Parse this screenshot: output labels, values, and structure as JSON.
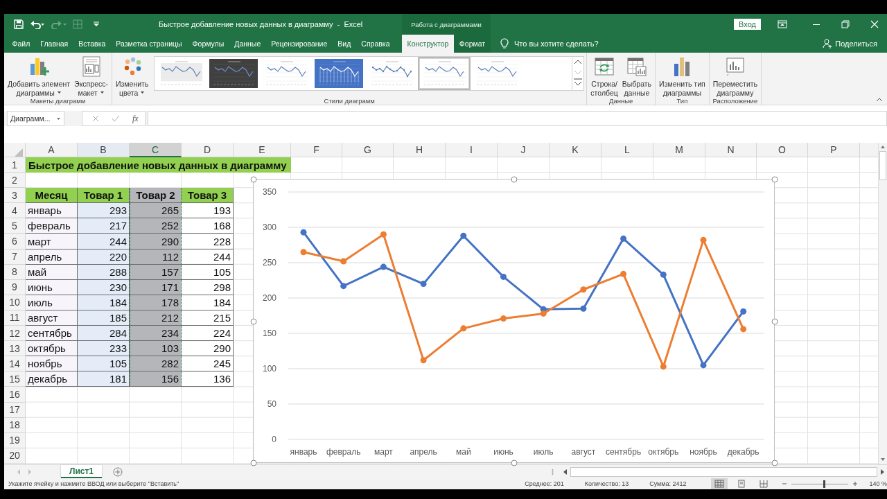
{
  "title_bar": {
    "title": "Быстрое добавление новых данных в диаграмму  -  Excel",
    "context_header": "Работа с диаграммами",
    "sign_in": "Вход"
  },
  "ribbon": {
    "tabs": [
      {
        "label": "Файл",
        "selected": false
      },
      {
        "label": "Главная",
        "selected": false
      },
      {
        "label": "Вставка",
        "selected": false
      },
      {
        "label": "Разметка страницы",
        "selected": false
      },
      {
        "label": "Формулы",
        "selected": false
      },
      {
        "label": "Данные",
        "selected": false
      },
      {
        "label": "Рецензирование",
        "selected": false
      },
      {
        "label": "Вид",
        "selected": false
      },
      {
        "label": "Справка",
        "selected": false
      },
      {
        "label": "Конструктор",
        "selected": true
      },
      {
        "label": "Формат",
        "selected": false
      }
    ],
    "tell_me": "Что вы хотите сделать?",
    "share": "Поделиться",
    "groups": [
      {
        "label": "Макеты диаграмм",
        "buttons": [
          {
            "kind": "add-element",
            "lines": [
              "Добавить элемент",
              "диаграммы"
            ],
            "dropdown": true
          },
          {
            "kind": "quick-layout",
            "lines": [
              "Экспресс-",
              "макет"
            ],
            "dropdown": true
          }
        ]
      },
      {
        "label": "Стили диаграмм",
        "buttons": [
          {
            "kind": "colors",
            "lines": [
              "Изменить",
              "цвета"
            ],
            "dropdown": true
          }
        ],
        "gallery": [
          {
            "kind": "light",
            "selected": false
          },
          {
            "kind": "dark",
            "selected": false
          },
          {
            "kind": "plain",
            "selected": false
          },
          {
            "kind": "blue",
            "selected": false
          },
          {
            "kind": "markers",
            "selected": false
          },
          {
            "kind": "plain",
            "selected": true
          },
          {
            "kind": "plain",
            "selected": false
          }
        ]
      },
      {
        "label": "Данные",
        "buttons": [
          {
            "kind": "switch",
            "lines": [
              "Строка/",
              "столбец"
            ],
            "dropdown": false
          },
          {
            "kind": "select-data",
            "lines": [
              "Выбрать",
              "данные"
            ],
            "dropdown": false
          }
        ]
      },
      {
        "label": "Тип",
        "buttons": [
          {
            "kind": "chart-type",
            "lines": [
              "Изменить тип",
              "диаграммы"
            ],
            "dropdown": false
          }
        ]
      },
      {
        "label": "Расположение",
        "buttons": [
          {
            "kind": "move-chart",
            "lines": [
              "Переместить",
              "диаграмму"
            ],
            "dropdown": false
          }
        ]
      }
    ]
  },
  "formula_bar": {
    "name_box": "Диаграмм...",
    "function_label": "fx"
  },
  "sheet": {
    "columns": [
      {
        "label": "A",
        "selected": false,
        "referenced": false
      },
      {
        "label": "B",
        "selected": false,
        "referenced": true
      },
      {
        "label": "C",
        "selected": true,
        "referenced": false
      },
      {
        "label": "D",
        "selected": false,
        "referenced": false
      },
      {
        "label": "E",
        "selected": false,
        "referenced": false
      },
      {
        "label": "F",
        "selected": false,
        "referenced": false
      },
      {
        "label": "G",
        "selected": false,
        "referenced": false
      },
      {
        "label": "H",
        "selected": false,
        "referenced": false
      },
      {
        "label": "I",
        "selected": false,
        "referenced": false
      },
      {
        "label": "J",
        "selected": false,
        "referenced": false
      },
      {
        "label": "K",
        "selected": false,
        "referenced": false
      },
      {
        "label": "L",
        "selected": false,
        "referenced": false
      },
      {
        "label": "M",
        "selected": false,
        "referenced": false
      },
      {
        "label": "N",
        "selected": false,
        "referenced": false
      },
      {
        "label": "O",
        "selected": false,
        "referenced": false
      },
      {
        "label": "P",
        "selected": false,
        "referenced": false
      }
    ],
    "rows": [
      {
        "number": "1",
        "kind": "title",
        "cells": [
          "Быстрое добавление новых данных в диаграмму"
        ]
      },
      {
        "number": "2",
        "kind": "empty",
        "cells": []
      },
      {
        "number": "3",
        "kind": "header",
        "cells": [
          "Месяц",
          "Товар 1",
          "Товар 2",
          "Товар 3"
        ]
      },
      {
        "number": "4",
        "kind": "data",
        "cells": [
          "январь",
          "293",
          "265",
          "193"
        ]
      },
      {
        "number": "5",
        "kind": "data",
        "cells": [
          "февраль",
          "217",
          "252",
          "168"
        ]
      },
      {
        "number": "6",
        "kind": "data",
        "cells": [
          "март",
          "244",
          "290",
          "228"
        ]
      },
      {
        "number": "7",
        "kind": "data",
        "cells": [
          "апрель",
          "220",
          "112",
          "244"
        ]
      },
      {
        "number": "8",
        "kind": "data",
        "cells": [
          "май",
          "288",
          "157",
          "105"
        ]
      },
      {
        "number": "9",
        "kind": "data",
        "cells": [
          "июнь",
          "230",
          "171",
          "298"
        ]
      },
      {
        "number": "10",
        "kind": "data",
        "cells": [
          "июль",
          "184",
          "178",
          "184"
        ]
      },
      {
        "number": "11",
        "kind": "data",
        "cells": [
          "август",
          "185",
          "212",
          "215"
        ]
      },
      {
        "number": "12",
        "kind": "data",
        "cells": [
          "сентябрь",
          "284",
          "234",
          "224"
        ]
      },
      {
        "number": "13",
        "kind": "data",
        "cells": [
          "октябрь",
          "233",
          "103",
          "290"
        ]
      },
      {
        "number": "14",
        "kind": "data",
        "cells": [
          "ноябрь",
          "105",
          "282",
          "245"
        ]
      },
      {
        "number": "15",
        "kind": "data",
        "cells": [
          "декабрь",
          "181",
          "156",
          "136"
        ]
      },
      {
        "number": "16",
        "kind": "empty",
        "cells": []
      },
      {
        "number": "17",
        "kind": "empty",
        "cells": []
      },
      {
        "number": "18",
        "kind": "empty",
        "cells": []
      },
      {
        "number": "19",
        "kind": "empty",
        "cells": []
      },
      {
        "number": "20",
        "kind": "empty",
        "cells": []
      }
    ],
    "chart": {
      "chart_data": {
        "type": "line",
        "categories": [
          "январь",
          "февраль",
          "март",
          "апрель",
          "май",
          "июнь",
          "июль",
          "август",
          "сентябрь",
          "октябрь",
          "ноябрь",
          "декабрь"
        ],
        "series": [
          {
            "color": "#4472c4",
            "marker": true,
            "values": [
              293,
              217,
              244,
              220,
              288,
              230,
              184,
              185,
              284,
              233,
              105,
              181
            ]
          },
          {
            "color": "#ed7d31",
            "marker": true,
            "values": [
              265,
              252,
              290,
              112,
              157,
              171,
              178,
              212,
              234,
              103,
              282,
              156
            ]
          }
        ],
        "grid": true,
        "ylim": [
          0,
          350
        ],
        "yticks": [
          0,
          50,
          100,
          150,
          200,
          250,
          300,
          350
        ]
      }
    }
  },
  "sheet_tabs": [
    {
      "label": "Лист1",
      "selected": true
    }
  ],
  "status_bar": {
    "message": "Укажите ячейку и нажмите ВВОД или выберите \"Вставить\"",
    "average": "Среднее: 201",
    "count": "Количество: 13",
    "sum": "Сумма: 2412",
    "views": [
      {
        "kind": "normal",
        "selected": true
      },
      {
        "kind": "page-layout",
        "selected": false
      },
      {
        "kind": "page-break",
        "selected": false
      }
    ],
    "zoom": {
      "level": 0.57,
      "reading": "140 %"
    }
  }
}
